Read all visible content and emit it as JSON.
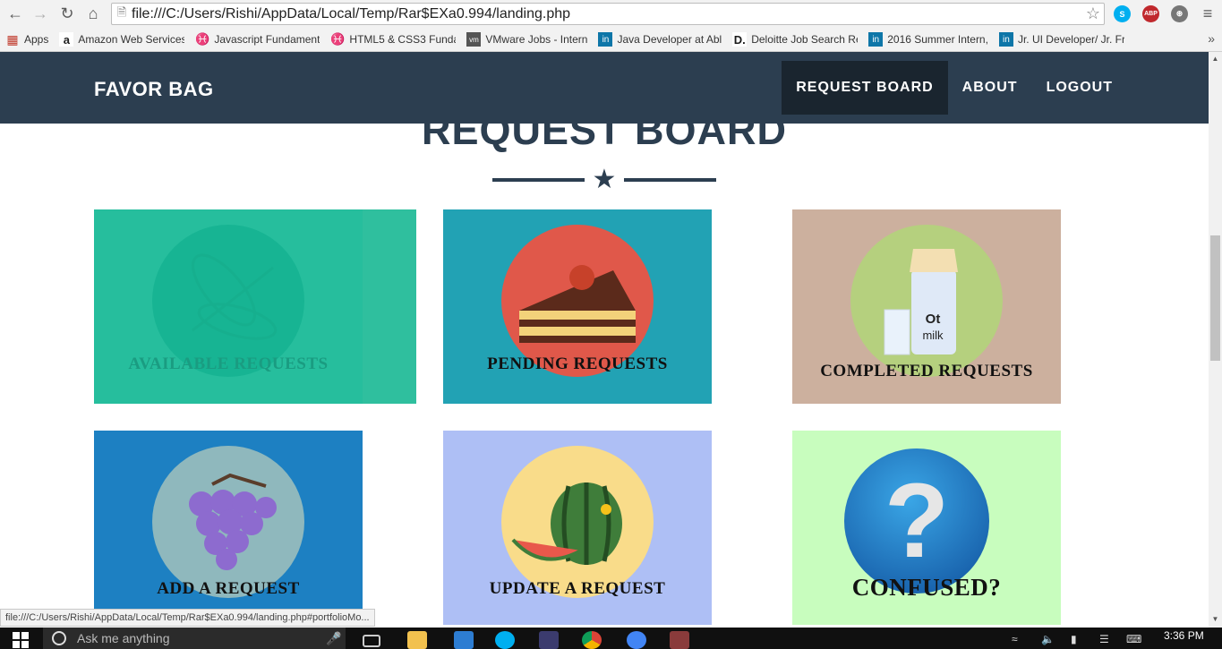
{
  "browser": {
    "url": "file:///C:/Users/Rishi/AppData/Local/Temp/Rar$EXa0.994/landing.php",
    "status_url": "file:///C:/Users/Rishi/AppData/Local/Temp/Rar$EXa0.994/landing.php#portfolioMo...",
    "extensions": [
      "S",
      "ABP",
      "⊛"
    ],
    "bookmarks": [
      {
        "label": "Apps",
        "icon": "apps-grid-icon",
        "color": "#c0392b"
      },
      {
        "label": "Amazon Web Services",
        "icon": "amazon-icon",
        "color": "#222222"
      },
      {
        "label": "Javascript Fundament",
        "icon": "course-icon",
        "color": "#b9854b"
      },
      {
        "label": "HTML5 & CSS3 Funda",
        "icon": "course-icon",
        "color": "#b9854b"
      },
      {
        "label": "VMware Jobs - Intern",
        "icon": "vmware-icon",
        "color": "#555555"
      },
      {
        "label": "Java Developer at Abl",
        "icon": "linkedin-icon",
        "color": "#0e76a8"
      },
      {
        "label": "Deloitte Job Search Re",
        "icon": "deloitte-icon",
        "color": "#1b1b1b"
      },
      {
        "label": "2016 Summer Intern,",
        "icon": "linkedin-icon",
        "color": "#0e76a8"
      },
      {
        "label": "Jr. UI Developer/ Jr. Fr",
        "icon": "linkedin-icon",
        "color": "#0e76a8"
      }
    ]
  },
  "site": {
    "brand": "FAVOR BAG",
    "nav": [
      "REQUEST BOARD",
      "ABOUT",
      "LOGOUT"
    ],
    "active_nav": "REQUEST BOARD",
    "heading": "REQUEST BOARD",
    "colors": {
      "nav": "#2c3e50",
      "nav_active": "#1a252f",
      "hover": "#18bc9c"
    }
  },
  "tiles": [
    {
      "caption": "AVAILABLE REQUESTS",
      "bg": "#2fbf9e",
      "circle": "#17b08f",
      "icon": "corn-icon",
      "hovered": true
    },
    {
      "caption": "PENDING REQUESTS",
      "bg": "#22a2b4",
      "circle": "#e0584a",
      "icon": "cake-icon",
      "hovered": false
    },
    {
      "caption": "COMPLETED REQUESTS",
      "bg": "#ccb09e",
      "circle": "#b5d07e",
      "icon": "milk-icon",
      "hovered": false
    },
    {
      "caption": "ADD A REQUEST",
      "bg": "#1d80c2",
      "circle": "#8fb8bd",
      "icon": "grapes-icon",
      "hovered": false
    },
    {
      "caption": "UPDATE A REQUEST",
      "bg": "#aebff5",
      "circle": "#f9dc8a",
      "icon": "watermelon-icon",
      "hovered": false
    },
    {
      "caption": "CONFUSED?",
      "bg": "#c8fdbe",
      "circle": "#1d7fc4",
      "icon": "question-icon",
      "hovered": false
    }
  ],
  "taskbar": {
    "search_placeholder": "Ask me anything",
    "time": "3:36 PM"
  }
}
